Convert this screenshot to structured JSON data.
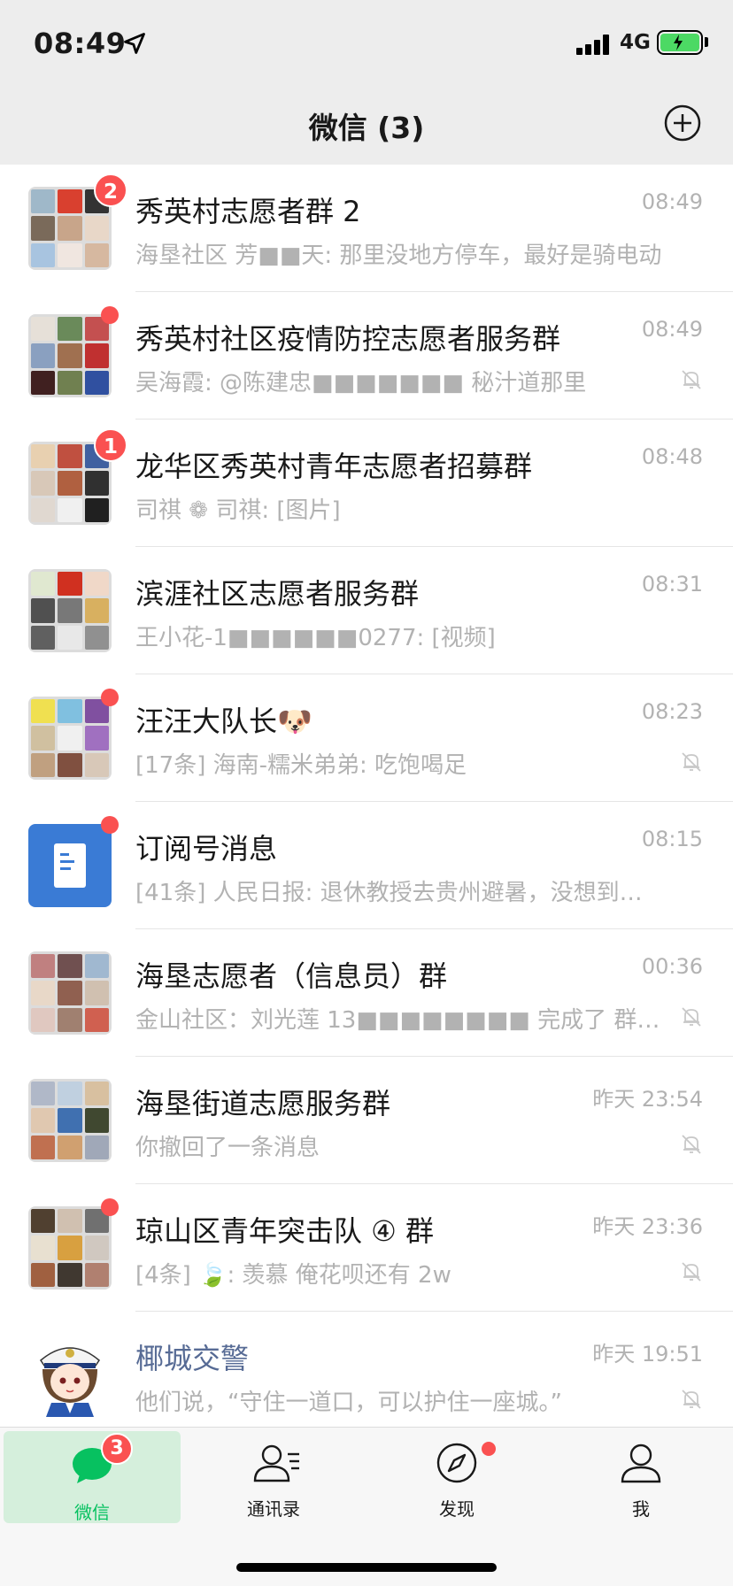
{
  "status_bar": {
    "time": "08:49",
    "network": "4G"
  },
  "nav": {
    "title": "微信 (3)"
  },
  "colors": {
    "accent": "#07c160",
    "badge": "#fa5151",
    "official_title": "#576b95"
  },
  "chats": [
    {
      "title": "秀英村志愿者群 2",
      "time": "08:49",
      "preview": "海垦社区 芳■■天: 那里没地方停车，最好是骑电动",
      "badge": "2",
      "muted": false
    },
    {
      "title": "秀英村社区疫情防控志愿者服务群",
      "time": "08:49",
      "preview": "吴海霞: @陈建忠■■■■■■■ 秘汁道那里",
      "badge": "",
      "dot": true,
      "muted": true
    },
    {
      "title": "龙华区秀英村青年志愿者招募群",
      "time": "08:48",
      "preview": "司祺 ❁ 司祺: [图片]",
      "badge": "1",
      "muted": false
    },
    {
      "title": "滨涯社区志愿者服务群",
      "time": "08:31",
      "preview": "王小花-1■■■■■■0277: [视频]",
      "badge": "",
      "muted": false
    },
    {
      "title": "汪汪大队长🐶",
      "time": "08:23",
      "preview": "[17条] 海南-糯米弟弟: 吃饱喝足",
      "badge": "",
      "dot": true,
      "muted": true
    },
    {
      "title": "订阅号消息",
      "time": "08:15",
      "preview": "[41条] 人民日报: 退休教授去贵州避暑，没想到…",
      "badge": "",
      "dot": true,
      "muted": false
    },
    {
      "title": "海垦志愿者（信息员）群",
      "time": "00:36",
      "preview": "金山社区：刘光莲 13■■■■■■■■ 完成了 群…",
      "badge": "",
      "muted": true
    },
    {
      "title": "海垦街道志愿服务群",
      "time": "昨天 23:54",
      "preview": "你撤回了一条消息",
      "badge": "",
      "muted": true
    },
    {
      "title": "琼山区青年突击队 ④ 群",
      "time": "昨天 23:36",
      "preview": "[4条] 🍃: 羡慕 俺花呗还有 2w",
      "badge": "",
      "dot": true,
      "muted": true
    },
    {
      "title": "椰城交警",
      "time": "昨天 19:51",
      "preview": "他们说，“守住一道口，可以护住一座城。”",
      "badge": "",
      "muted": true
    }
  ],
  "tabs": [
    {
      "label": "微信",
      "badge": "3",
      "icon": "chat-bubble-icon"
    },
    {
      "label": "通讯录",
      "icon": "contacts-icon"
    },
    {
      "label": "发现",
      "icon": "compass-icon"
    },
    {
      "label": "我",
      "icon": "person-icon"
    }
  ]
}
